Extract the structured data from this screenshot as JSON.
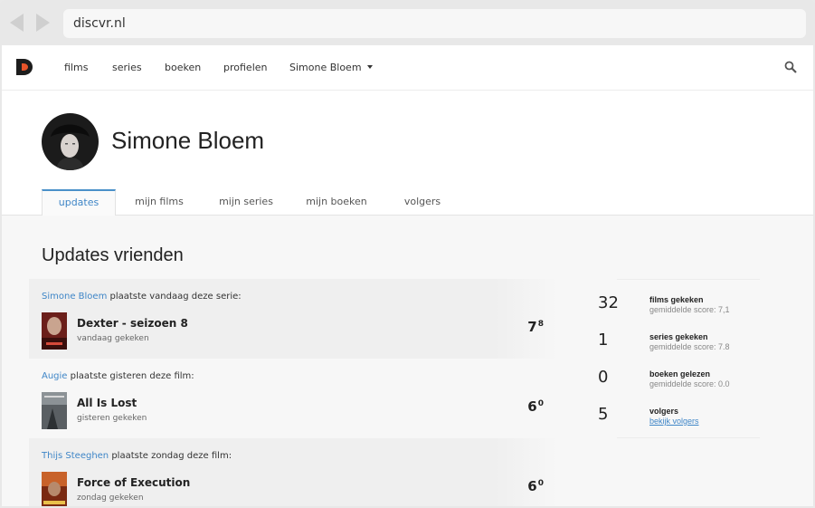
{
  "browser": {
    "url": "discvr.nl"
  },
  "colors": {
    "brand": "#e8542a",
    "accent": "#3f86c7"
  },
  "header": {
    "nav": [
      "films",
      "series",
      "boeken",
      "profielen"
    ],
    "user_menu": "Simone Bloem",
    "icons": {
      "logo": "discvr-logo",
      "search": "search-icon",
      "caret": "chevron-down-icon"
    }
  },
  "profile": {
    "name": "Simone Bloem",
    "tabs": [
      "updates",
      "mijn films",
      "mijn series",
      "mijn boeken",
      "volgers"
    ],
    "active_tab": "updates"
  },
  "feed": {
    "title": "Updates vrienden",
    "items": [
      {
        "user": "Simone Bloem",
        "action": "plaatste vandaag deze serie:",
        "title": "Dexter - seizoen 8",
        "subtitle": "vandaag gekeken",
        "score": "7",
        "score_decimal": "8"
      },
      {
        "user": "Augie",
        "action": "plaatste gisteren deze film:",
        "title": "All Is Lost",
        "subtitle": "gisteren gekeken",
        "score": "6",
        "score_decimal": "0"
      },
      {
        "user": "Thijs Steeghen",
        "action": "plaatste zondag deze film:",
        "title": "Force of Execution",
        "subtitle": "zondag gekeken",
        "score": "6",
        "score_decimal": "0"
      }
    ]
  },
  "stats": [
    {
      "value": "32",
      "label": "films gekeken",
      "sub": "gemiddelde score: 7,1"
    },
    {
      "value": "1",
      "label": "series gekeken",
      "sub": "gemiddelde score: 7.8"
    },
    {
      "value": "0",
      "label": "boeken gelezen",
      "sub": "gemiddelde score: 0.0"
    },
    {
      "value": "5",
      "label": "volgers",
      "sub": "bekijk volgers"
    }
  ]
}
